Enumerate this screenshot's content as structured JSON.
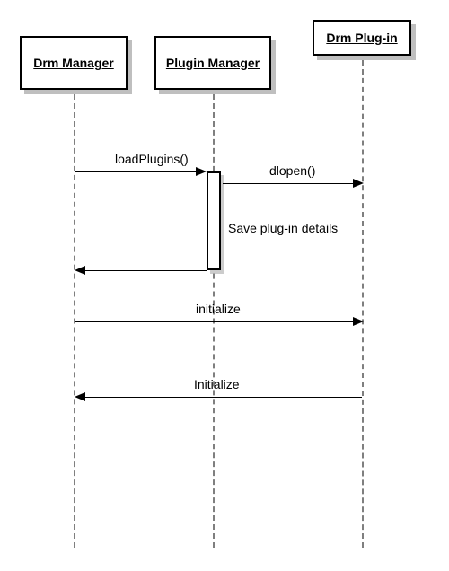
{
  "participants": {
    "drm_manager": "Drm Manager",
    "plugin_manager": "Plugin Manager",
    "drm_plugin": "Drm Plug-in"
  },
  "messages": {
    "load_plugins": "loadPlugins()",
    "dlopen": "dlopen()",
    "save_details": "Save plug-in details",
    "initialize_lc": "initialize",
    "initialize_uc": "Initialize"
  }
}
